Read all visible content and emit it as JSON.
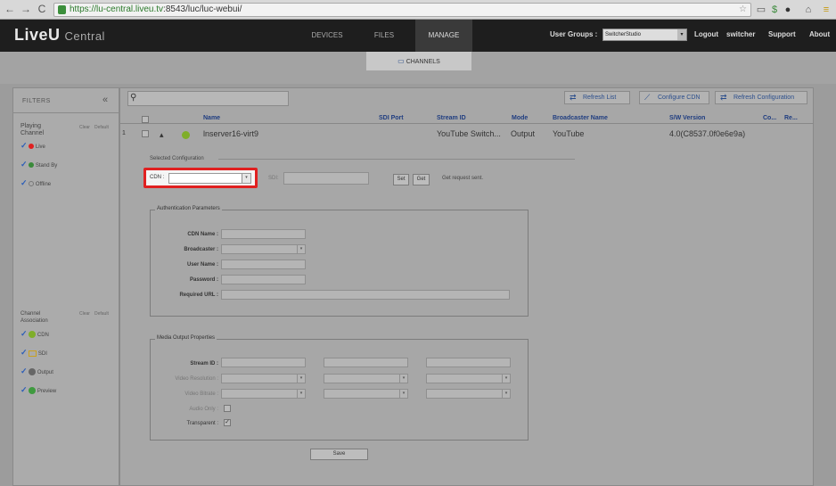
{
  "browser": {
    "url_scheme": "https://",
    "url_host": "lu-central.liveu.tv",
    "url_rest": ":8543/luc/luc-webui/",
    "icons": [
      "back-icon",
      "forward-icon",
      "reload-icon",
      "lock-icon",
      "star-icon",
      "cast-icon",
      "extension-icon",
      "menu-icon"
    ]
  },
  "header": {
    "logo_main": "LiveU",
    "logo_sub": "Central",
    "tabs": [
      "DEVICES",
      "FILES",
      "MANAGE"
    ],
    "active_tab": "MANAGE",
    "user_groups_label": "User Groups :",
    "user_group_value": "SwitcherStudio",
    "logout": "Logout",
    "username": "switcher",
    "support": "Support",
    "about": "About"
  },
  "subnav": {
    "channels": "CHANNELS"
  },
  "filters": {
    "title": "FILTERS",
    "collapse": "«",
    "playing_channel": {
      "label": "Playing Channel",
      "clear": "Clear",
      "default": "Default",
      "items": [
        {
          "label": "Live",
          "color": "#e02020"
        },
        {
          "label": "Stand By",
          "color": "#3a8a3a"
        },
        {
          "label": "Offline",
          "color": "#777777"
        }
      ]
    },
    "channel_association": {
      "label": "Channel Association",
      "clear": "Clear",
      "default": "Default",
      "items": [
        {
          "label": "CDN",
          "color": "#7fae2a"
        },
        {
          "label": "SDI",
          "color": "#c8a020"
        },
        {
          "label": "Output",
          "color": "#666666"
        },
        {
          "label": "Preview",
          "color": "#3f9a3f"
        }
      ]
    }
  },
  "toolbar": {
    "search_placeholder": "",
    "refresh_list": "Refresh List",
    "configure_cdn": "Configure CDN",
    "refresh_configuration": "Refresh Configuration"
  },
  "table": {
    "columns": [
      "Name",
      "SDI Port",
      "Stream ID",
      "Mode",
      "Broadcaster Name",
      "S/W Version",
      "Co...",
      "Re..."
    ],
    "rows": [
      {
        "index": "1",
        "name": "lnserver16-virt9",
        "sdi_port": "",
        "stream_id": "YouTube Switch...",
        "mode": "Output",
        "broadcaster": "YouTube",
        "sw_version": "4.0(C8537.0f0e6e9a)"
      }
    ]
  },
  "config": {
    "selected_configuration": "Selected Configuration",
    "cdn_label": "CDN :",
    "cdn_value": "",
    "sdi_label": "SDI:",
    "set": "Set",
    "get": "Get",
    "status": "Get request sent.",
    "auth": {
      "legend": "Authentication Parameters",
      "fields": [
        "CDN Name :",
        "Broadcaster :",
        "User Name :",
        "Password :",
        "Required URL :"
      ]
    },
    "media": {
      "legend": "Media Output Properties",
      "fields": [
        "Stream ID :",
        "Video Resolution :",
        "Video Bitrate :",
        "Audio Only :",
        "Transparent :"
      ]
    },
    "save": "Save"
  }
}
